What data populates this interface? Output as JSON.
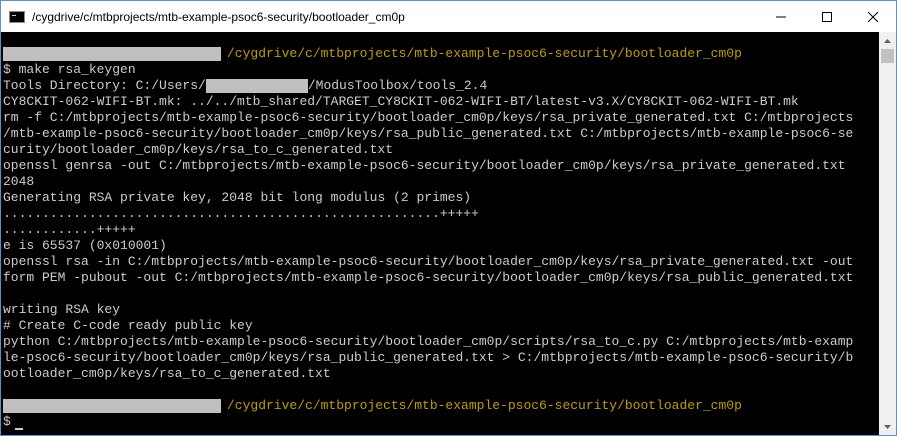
{
  "window": {
    "title": "/cygdrive/c/mtbprojects/mtb-example-psoc6-security/bootloader_cm0p",
    "app_icon": "terminal-icon",
    "controls": [
      "minimize-icon",
      "maximize-icon",
      "close-icon"
    ]
  },
  "colors": {
    "background": "#000000",
    "text": "#cccccc",
    "path": "#c19c00",
    "redaction": "#c0c0c0"
  },
  "terminal": {
    "prompt_path_1": "/cygdrive/c/mtbprojects/mtb-example-psoc6-security/bootloader_cm0p",
    "command_line": "$ make rsa_keygen",
    "tools_dir_prefix": "Tools Directory: C:/Users/",
    "tools_dir_suffix": "/ModusToolbox/tools_2.4",
    "lines": [
      "CY8CKIT-062-WIFI-BT.mk: ../../mtb_shared/TARGET_CY8CKIT-062-WIFI-BT/latest-v3.X/CY8CKIT-062-WIFI-BT.mk",
      "rm -f C:/mtbprojects/mtb-example-psoc6-security/bootloader_cm0p/keys/rsa_private_generated.txt C:/mtbprojects",
      "/mtb-example-psoc6-security/bootloader_cm0p/keys/rsa_public_generated.txt C:/mtbprojects/mtb-example-psoc6-se",
      "curity/bootloader_cm0p/keys/rsa_to_c_generated.txt",
      "openssl genrsa -out C:/mtbprojects/mtb-example-psoc6-security/bootloader_cm0p/keys/rsa_private_generated.txt",
      "2048",
      "Generating RSA private key, 2048 bit long modulus (2 primes)",
      "........................................................+++++",
      "............+++++",
      "e is 65537 (0x010001)",
      "openssl rsa -in C:/mtbprojects/mtb-example-psoc6-security/bootloader_cm0p/keys/rsa_private_generated.txt -out",
      "form PEM -pubout -out C:/mtbprojects/mtb-example-psoc6-security/bootloader_cm0p/keys/rsa_public_generated.txt",
      "",
      "writing RSA key",
      "# Create C-code ready public key",
      "python C:/mtbprojects/mtb-example-psoc6-security/bootloader_cm0p/scripts/rsa_to_c.py C:/mtbprojects/mtb-examp",
      "le-psoc6-security/bootloader_cm0p/keys/rsa_public_generated.txt > C:/mtbprojects/mtb-example-psoc6-security/b",
      "ootloader_cm0p/keys/rsa_to_c_generated.txt",
      ""
    ],
    "prompt_path_2": "/cygdrive/c/mtbprojects/mtb-example-psoc6-security/bootloader_cm0p",
    "final_prompt": "$"
  },
  "scrollbar": {
    "up_icon": "scroll-up-icon",
    "down_icon": "scroll-down-icon"
  }
}
